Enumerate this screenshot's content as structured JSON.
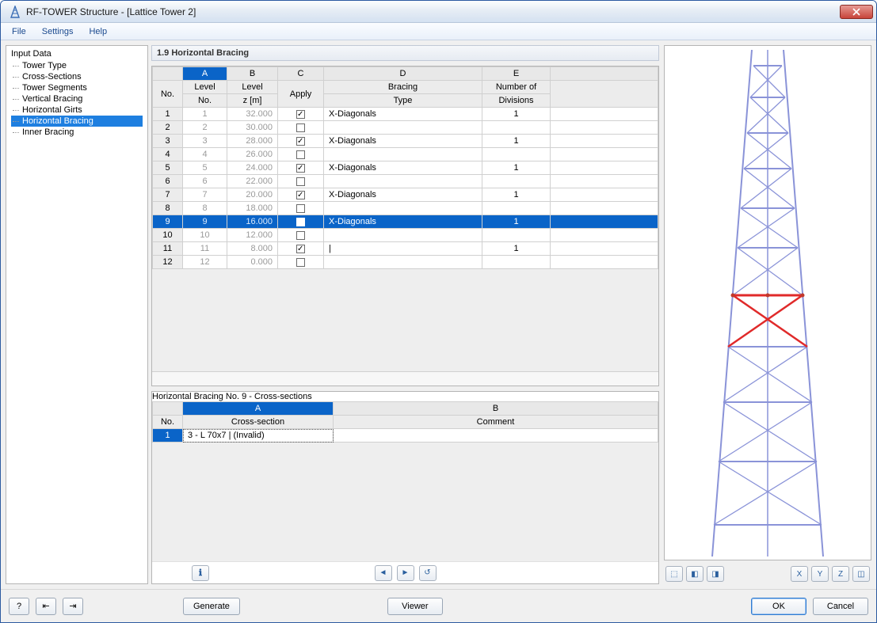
{
  "window_title": "RF-TOWER Structure - [Lattice Tower 2]",
  "menu": {
    "file": "File",
    "settings": "Settings",
    "help": "Help"
  },
  "sidebar": {
    "header": "Input Data",
    "items": [
      {
        "label": "Tower Type"
      },
      {
        "label": "Cross-Sections"
      },
      {
        "label": "Tower Segments"
      },
      {
        "label": "Vertical Bracing"
      },
      {
        "label": "Horizontal Girts"
      },
      {
        "label": "Horizontal Bracing",
        "selected": true
      },
      {
        "label": "Inner Bracing"
      }
    ]
  },
  "panel": {
    "title": "1.9 Horizontal Bracing",
    "columns": {
      "letters": [
        "A",
        "B",
        "C",
        "D",
        "E"
      ],
      "no": "No.",
      "a1": "Level",
      "a2": "No.",
      "b1": "Level",
      "b2": "z [m]",
      "c": "Apply",
      "d1": "Bracing",
      "d2": "Type",
      "e1": "Number of",
      "e2": "Divisions"
    },
    "rows": [
      {
        "no": "1",
        "level": "1",
        "z": "32.000",
        "apply": true,
        "type": "X-Diagonals",
        "div": "1"
      },
      {
        "no": "2",
        "level": "2",
        "z": "30.000",
        "apply": false,
        "type": "",
        "div": ""
      },
      {
        "no": "3",
        "level": "3",
        "z": "28.000",
        "apply": true,
        "type": "X-Diagonals",
        "div": "1"
      },
      {
        "no": "4",
        "level": "4",
        "z": "26.000",
        "apply": false,
        "type": "",
        "div": ""
      },
      {
        "no": "5",
        "level": "5",
        "z": "24.000",
        "apply": true,
        "type": "X-Diagonals",
        "div": "1"
      },
      {
        "no": "6",
        "level": "6",
        "z": "22.000",
        "apply": false,
        "type": "",
        "div": ""
      },
      {
        "no": "7",
        "level": "7",
        "z": "20.000",
        "apply": true,
        "type": "X-Diagonals",
        "div": "1"
      },
      {
        "no": "8",
        "level": "8",
        "z": "18.000",
        "apply": false,
        "type": "",
        "div": ""
      },
      {
        "no": "9",
        "level": "9",
        "z": "16.000",
        "apply": true,
        "type": "X-Diagonals",
        "div": "1",
        "selected": true
      },
      {
        "no": "10",
        "level": "10",
        "z": "12.000",
        "apply": false,
        "type": "",
        "div": ""
      },
      {
        "no": "11",
        "level": "11",
        "z": "8.000",
        "apply": true,
        "type": "|",
        "div": "1"
      },
      {
        "no": "12",
        "level": "12",
        "z": "0.000",
        "apply": false,
        "type": "",
        "div": ""
      }
    ]
  },
  "sub": {
    "title": "Horizontal Bracing No. 9  -  Cross-sections",
    "letters": [
      "A",
      "B"
    ],
    "hdr": {
      "no": "No.",
      "a": "Cross-section",
      "b": "Comment"
    },
    "rows": [
      {
        "no": "1",
        "a": "3 - L 70x7 | (Invalid)",
        "b": ""
      }
    ]
  },
  "footer": {
    "generate": "Generate",
    "viewer": "Viewer",
    "ok": "OK",
    "cancel": "Cancel"
  },
  "icons": {
    "info": "ℹ",
    "prev": "◄",
    "next": "►",
    "undo": "↺",
    "help": "?",
    "imp": "⇤",
    "exp": "⇥",
    "v1": "⬚",
    "v2": "◧",
    "v3": "◨",
    "vx": "X",
    "vy": "Y",
    "vz": "Z",
    "iso": "◫"
  }
}
